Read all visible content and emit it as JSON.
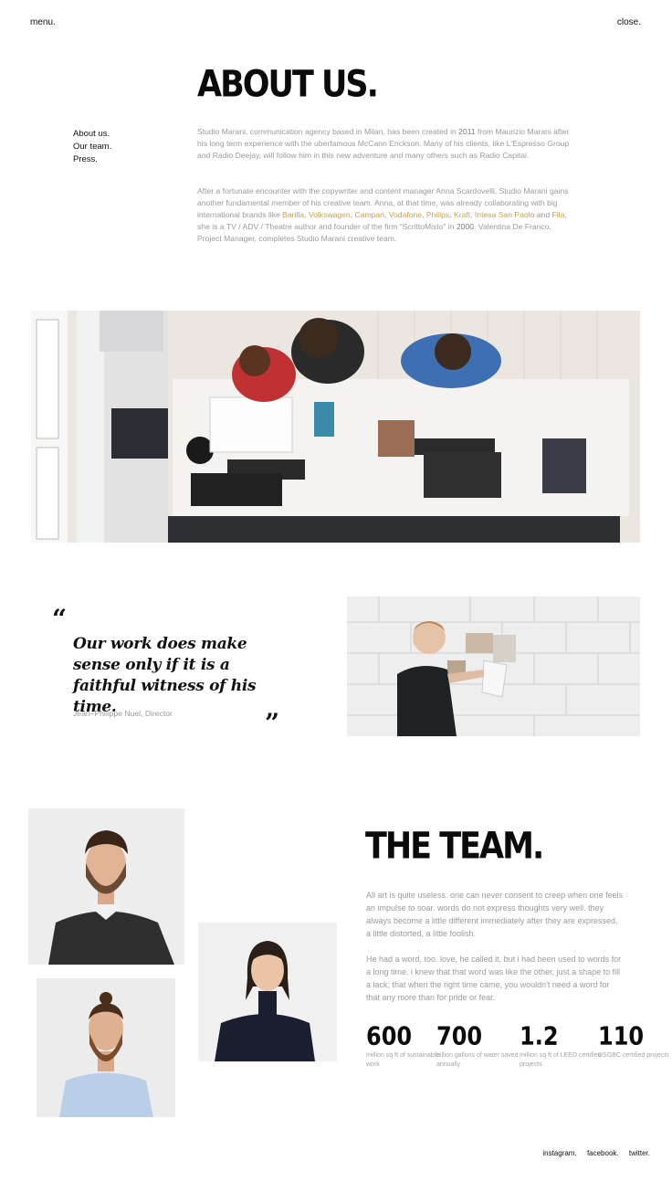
{
  "nav": {
    "menu_label": "menu.",
    "close_label": "close."
  },
  "about": {
    "title": "ABOUT US.",
    "side_nav": [
      "About us.",
      "Our team.",
      "Press."
    ],
    "p1": {
      "a": "Studio Marani, communication agency based in Milan, has been created in ",
      "year": "2011",
      "b": " from Maurizio Marani after his long term experience with the uberfamous McCann Erickson. Many of his clients, like L'Espresso Group and Radio Deejay, will follow him in this new adventure and many others such as Radio Capital."
    },
    "p2": {
      "a": "After a fortunate encounter with the copywriter and content manager Anna Scardovelli, Studio Marani gains another fundamental member of his creative team. Anna, at that time, was already collaborating with big international brands like ",
      "brand_1": "Barilla",
      "sep_1": ", ",
      "brand_2": "Volkswagen",
      "sep_2": ", ",
      "brand_3": "Campari",
      "sep_3": ", ",
      "brand_4": "Vodafone",
      "sep_4": ", ",
      "brand_5": "Philips",
      "sep_5": ", ",
      "brand_6": "Kraft",
      "sep_6": ", ",
      "brand_7": "Intesa San Paolo",
      "sep_7": " and ",
      "brand_8": "Fila",
      "b": ", she is a TV / ADV / Theatre author and founder of the firm “ScrittoMisto” in ",
      "year": "2000",
      "c": ". Valentina De Franco, Project Manager, completes Studio Marani creative team."
    }
  },
  "quote": {
    "open_mark": "“",
    "close_mark": "”",
    "text": "Our work does make sense only if it is a faithful witness of his time.",
    "author": "Jean–Philippe Nuel, Director"
  },
  "team": {
    "title": "THE TEAM.",
    "p1": "All art is quite useless. one can never consent to creep when one feels an impulse to soar. words do not express thoughts very well. they always become a little different immediately after they are expressed, a little distorted, a little foolish.",
    "p2": "He had a word, too. love, he called it. but i had been used to words for a long time. i knew that that word was like the other, just a shape to fill a lack; that when the right time came, you wouldn't need a word for that any more than for pride or fear.",
    "stats": [
      {
        "value": "600",
        "label": "million sq ft of sustainable work"
      },
      {
        "value": "700",
        "label": "billion gallons of water saved annually"
      },
      {
        "value": "1.2",
        "label": "million sq ft of LEED certified projects"
      },
      {
        "value": "110",
        "label": "USGBC certified projects"
      }
    ]
  },
  "footer": {
    "links": [
      "instagram.",
      "facebook.",
      "twitter."
    ]
  },
  "colors": {
    "accent_brand": "#c3a355",
    "body_text": "#9a9a9a",
    "heading": "#0b0b0b"
  }
}
